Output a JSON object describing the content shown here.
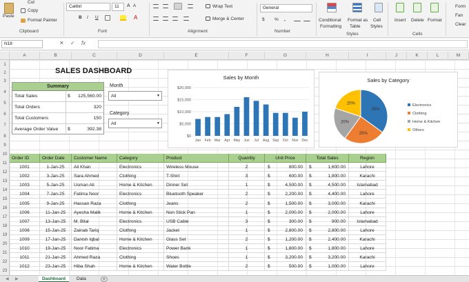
{
  "ribbon": {
    "clipboard": {
      "paste": "Paste",
      "cut": "Cut",
      "copy": "Copy",
      "format_painter": "Format Painter",
      "label": "Clipboard"
    },
    "font": {
      "name": "Calibri",
      "size": "11",
      "bold": "B",
      "italic": "I",
      "underline": "U",
      "label": "Font"
    },
    "alignment": {
      "wrap_text": "Wrap Text",
      "merge_center": "Merge & Center",
      "label": "Alignment"
    },
    "number": {
      "format": "General",
      "currency": "$",
      "percent": "%",
      "comma": ",",
      "label": "Number"
    },
    "styles": {
      "conditional": "Conditional",
      "formatting": "Formatting",
      "format_as": "Format as",
      "table": "Table",
      "cell": "Cell",
      "styles_btn": "Styles",
      "label": "Styles"
    },
    "cells": {
      "insert": "Insert",
      "delete": "Delete",
      "format": "Format",
      "label": "Cells"
    },
    "editing": {
      "item1": "Form",
      "item2": "Fan",
      "item3": "Clear"
    }
  },
  "formula_bar": {
    "name_box": "N18",
    "fx": "fx"
  },
  "columns": [
    "A",
    "B",
    "C",
    "D",
    "E",
    "F",
    "G",
    "H",
    "I",
    "J",
    "K",
    "L",
    "M",
    "N"
  ],
  "rows": [
    "1",
    "2",
    "3",
    "4",
    "5",
    "6",
    "7",
    "8",
    "9",
    "10",
    "11",
    "12",
    "13",
    "14",
    "15",
    "16",
    "17",
    "18",
    "19",
    "20",
    "21",
    "22",
    "23"
  ],
  "dashboard": {
    "title": "SALES DASHBOARD",
    "summary": {
      "header": "Summary",
      "rows": [
        {
          "label": "Total Sales",
          "currency": "$",
          "value": "125,560.00"
        },
        {
          "label": "Total Orders",
          "currency": "",
          "value": "320"
        },
        {
          "label": "Total Customers",
          "currency": "",
          "value": "150"
        },
        {
          "label": "Average Order Value",
          "currency": "$",
          "value": "392.38"
        }
      ]
    },
    "month_filter": {
      "label": "Month",
      "value": "All"
    },
    "category_filter": {
      "label": "Category",
      "value": "All"
    }
  },
  "chart_data": [
    {
      "type": "bar",
      "title": "Sales by Month",
      "categories": [
        "Jan",
        "Feb",
        "Mar",
        "Apr",
        "May",
        "Jun",
        "Jul",
        "Aug",
        "Sep",
        "Oct",
        "Nov",
        "Dec"
      ],
      "values": [
        7000,
        7800,
        7800,
        9000,
        12000,
        16000,
        14500,
        13000,
        9500,
        9500,
        7500,
        10000
      ],
      "ylim": [
        0,
        20000
      ],
      "yticks": [
        "$0",
        "$5,000",
        "$10,000",
        "$15,000",
        "$20,000"
      ],
      "color": "#2e75b6",
      "grid": true
    },
    {
      "type": "pie",
      "title": "Sales by Category",
      "slices": [
        {
          "name": "Electronics",
          "value": 35,
          "label": "35%",
          "color": "#2e75b6"
        },
        {
          "name": "Clothing",
          "value": 25,
          "label": "25%",
          "color": "#ed7d31"
        },
        {
          "name": "Home & Kitchen",
          "value": 20,
          "label": "20%",
          "color": "#a5a5a5"
        },
        {
          "name": "Others",
          "value": 20,
          "label": "20%",
          "color": "#ffc000"
        }
      ],
      "legend": "right"
    }
  ],
  "orders": {
    "headers": [
      "Order ID",
      "Order Date",
      "Customer Name",
      "Category",
      "Product",
      "Quantity",
      "Unit Price",
      "Total Sales",
      "Region"
    ],
    "rows": [
      [
        "1001",
        "1-Jan-25",
        "Ali Khan",
        "Electronics",
        "Wireless Mouse",
        "2",
        "$",
        "800.00",
        "$",
        "1,600.00",
        "Lahore"
      ],
      [
        "1002",
        "3-Jan-25",
        "Sara Ahmed",
        "Clothing",
        "T-Shirt",
        "3",
        "$",
        "600.00",
        "$",
        "1,800.00",
        "Karachi"
      ],
      [
        "1003",
        "5-Jan-25",
        "Usman Ali",
        "Home & Kitchen",
        "Dinner Set",
        "1",
        "$",
        "4,500.00",
        "$",
        "4,500.00",
        "Islamabad"
      ],
      [
        "1004",
        "7-Jan-25",
        "Fatima Noor",
        "Electronics",
        "Bluetooth Speaker",
        "2",
        "$",
        "2,200.00",
        "$",
        "4,400.00",
        "Lahore"
      ],
      [
        "1005",
        "9-Jan-25",
        "Hassan Raza",
        "Clothing",
        "Jeans",
        "2",
        "$",
        "1,500.00",
        "$",
        "3,000.00",
        "Karachi"
      ],
      [
        "1006",
        "11-Jan-25",
        "Ayesha Malik",
        "Home & Kitchen",
        "Non Stick Pan",
        "1",
        "$",
        "2,000.00",
        "$",
        "2,000.00",
        "Lahore"
      ],
      [
        "1007",
        "13-Jan-25",
        "M. Bilal",
        "Electronics",
        "USB Cable",
        "3",
        "$",
        "300.00",
        "$",
        "900.00",
        "Islamabad"
      ],
      [
        "1008",
        "15-Jan-25",
        "Zainab Tariq",
        "Clothing",
        "Jacket",
        "1",
        "$",
        "2,800.00",
        "$",
        "2,800.00",
        "Lahore"
      ],
      [
        "1009",
        "17-Jan-25",
        "Danish Iqbal",
        "Home & Kitchen",
        "Glass Set",
        "2",
        "$",
        "1,200.00",
        "$",
        "2,400.00",
        "Karachi"
      ],
      [
        "1010",
        "19-Jan-25",
        "Noor Fatima",
        "Electronics",
        "Power Bank",
        "1",
        "$",
        "1,800.00",
        "$",
        "1,800.00",
        "Lahore"
      ],
      [
        "1011",
        "21-Jan-25",
        "Ahmed Raza",
        "Clothing",
        "Shoes",
        "1",
        "$",
        "3,200.00",
        "$",
        "3,200.00",
        "Karachi"
      ],
      [
        "1012",
        "23-Jan-25",
        "Hiba Shah",
        "Home & Kitchen",
        "Water Bottle",
        "2",
        "$",
        "500.00",
        "$",
        "1,000.00",
        "Lahore"
      ]
    ]
  },
  "sheets": {
    "tab1": "Dashboard",
    "tab2": "Data",
    "add": "+"
  }
}
